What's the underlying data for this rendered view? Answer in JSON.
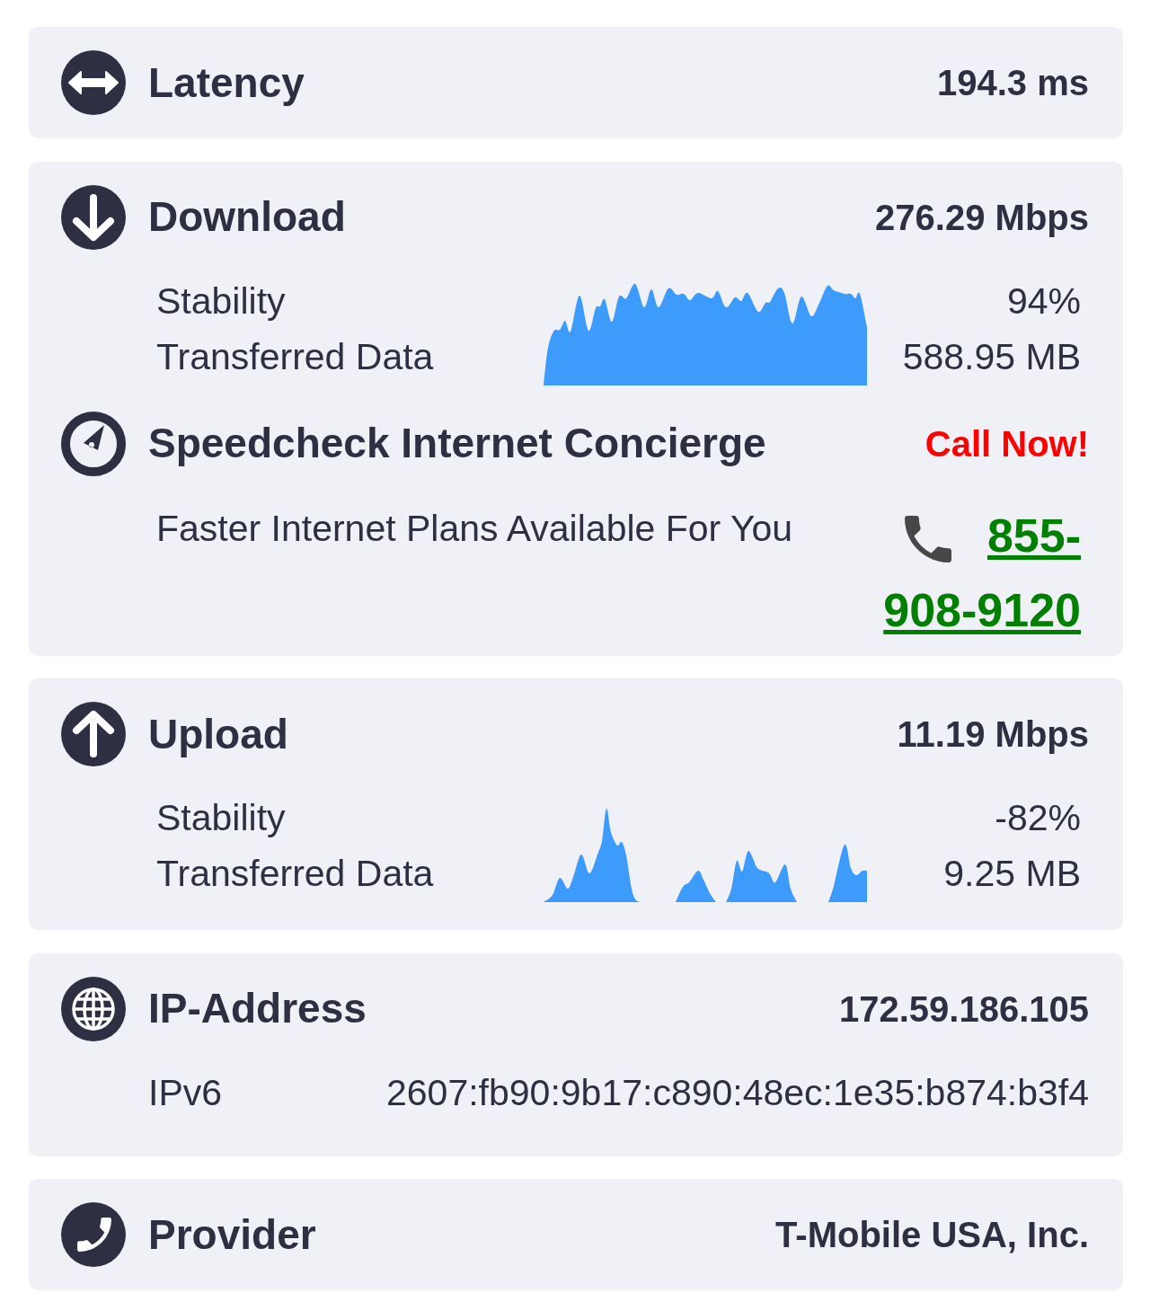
{
  "latency": {
    "label": "Latency",
    "value": "194.3 ms"
  },
  "download": {
    "label": "Download",
    "value": "276.29 Mbps",
    "stats": [
      {
        "label": "Stability",
        "value": "94%"
      },
      {
        "label": "Transferred Data",
        "value": "588.95 MB"
      }
    ]
  },
  "concierge": {
    "title": "Speedcheck Internet Concierge",
    "badge": "Call Now!",
    "text": "Faster Internet Plans Available For You",
    "phone": "855-908-9120"
  },
  "upload": {
    "label": "Upload",
    "value": "11.19 Mbps",
    "stats": [
      {
        "label": "Stability",
        "value": "-82%"
      },
      {
        "label": "Transferred Data",
        "value": "9.25 MB"
      }
    ]
  },
  "ip_address": {
    "label": "IP-Address",
    "value": "172.59.186.105",
    "rows": [
      {
        "label": "IPv6",
        "value": "2607:fb90:9b17:c890:48ec:1e35:b874:b3f4"
      }
    ]
  },
  "provider": {
    "label": "Provider",
    "value": "T-Mobile USA, Inc."
  }
}
